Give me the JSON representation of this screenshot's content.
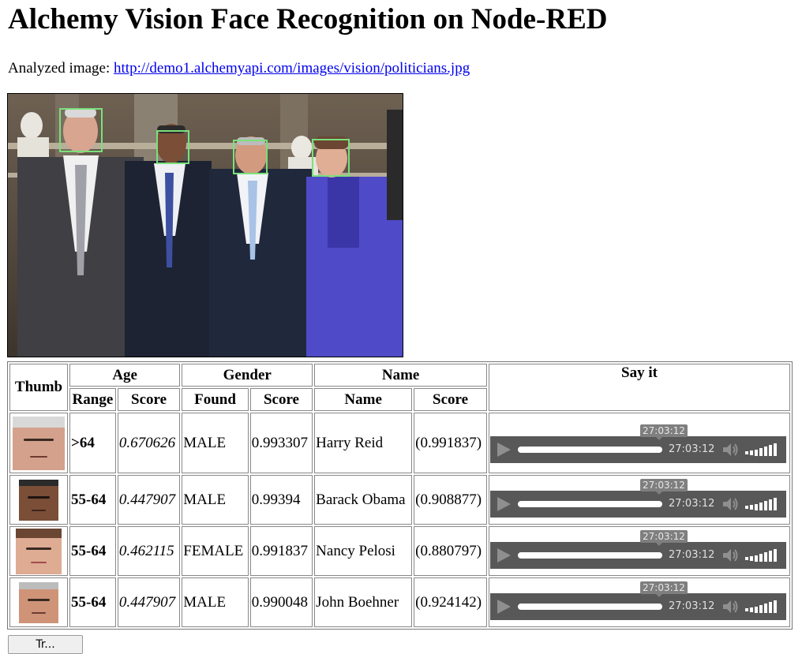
{
  "page": {
    "title": "Alchemy Vision Face Recognition on Node-RED",
    "analyzed_label": "Analyzed image:",
    "image_url": "http://demo1.alchemyapi.com/images/vision/politicians.jpg"
  },
  "table": {
    "group_headers": {
      "thumb": "Thumb",
      "age": "Age",
      "gender": "Gender",
      "name": "Name",
      "say": "Say it"
    },
    "sub_headers": {
      "range": "Range",
      "age_score": "Score",
      "found": "Found",
      "gender_score": "Score",
      "name": "Name",
      "name_score": "Score"
    },
    "rows": [
      {
        "range": ">64",
        "age_score": "0.670626",
        "gender": "MALE",
        "gender_score": "0.993307",
        "name": "Harry Reid",
        "name_score": "(0.991837)"
      },
      {
        "range": "55-64",
        "age_score": "0.447907",
        "gender": "MALE",
        "gender_score": "0.99394",
        "name": "Barack Obama",
        "name_score": "(0.908877)"
      },
      {
        "range": "55-64",
        "age_score": "0.462115",
        "gender": "FEMALE",
        "gender_score": "0.991837",
        "name": "Nancy Pelosi",
        "name_score": "(0.880797)"
      },
      {
        "range": "55-64",
        "age_score": "0.447907",
        "gender": "MALE",
        "gender_score": "0.990048",
        "name": "John Boehner",
        "name_score": "(0.924142)"
      }
    ]
  },
  "player": {
    "tooltip_time": "27:03:12",
    "current_time": "27:03:12"
  },
  "colors": {
    "face_box": "#7be07b",
    "player_bg": "#585858",
    "link": "#0000ee"
  },
  "bottom_button": {
    "label": "Tr..."
  }
}
